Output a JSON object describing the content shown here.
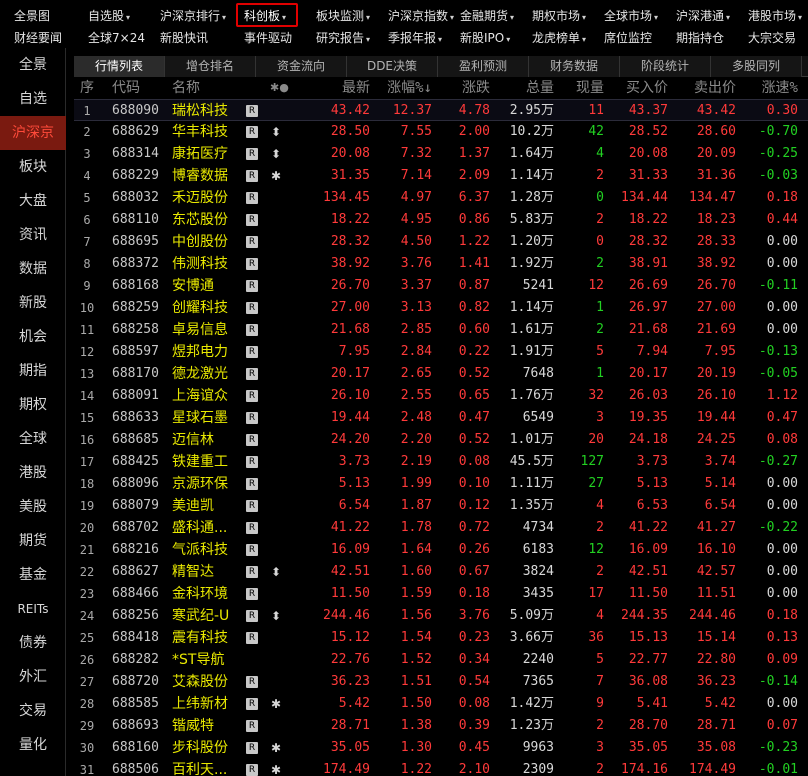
{
  "menu": {
    "row1": [
      {
        "label": "全景图",
        "dropdown": false
      },
      {
        "label": "自选股",
        "dropdown": true
      },
      {
        "label": "沪深京排行",
        "dropdown": true
      },
      {
        "label": "科创板",
        "dropdown": true,
        "active": true
      },
      {
        "label": "板块监测",
        "dropdown": true
      },
      {
        "label": "沪深京指数",
        "dropdown": true
      },
      {
        "label": "金融期货",
        "dropdown": true
      },
      {
        "label": "期权市场",
        "dropdown": true
      },
      {
        "label": "全球市场",
        "dropdown": true
      },
      {
        "label": "沪深港通",
        "dropdown": true
      },
      {
        "label": "港股市场",
        "dropdown": true
      }
    ],
    "row2": [
      {
        "label": "财经要闻",
        "dropdown": false
      },
      {
        "label": "全球7×24",
        "dropdown": false
      },
      {
        "label": "新股快讯",
        "dropdown": false
      },
      {
        "label": "事件驱动",
        "dropdown": false
      },
      {
        "label": "研究报告",
        "dropdown": true
      },
      {
        "label": "季报年报",
        "dropdown": true
      },
      {
        "label": "新股IPO",
        "dropdown": true
      },
      {
        "label": "龙虎榜单",
        "dropdown": true
      },
      {
        "label": "席位监控",
        "dropdown": false
      },
      {
        "label": "期指持仓",
        "dropdown": false
      },
      {
        "label": "大宗交易",
        "dropdown": false
      }
    ]
  },
  "sidebar": {
    "items": [
      "全景",
      "自选",
      "沪深京",
      "板块",
      "大盘",
      "资讯",
      "数据",
      "新股",
      "机会",
      "期指",
      "期权",
      "全球",
      "港股",
      "美股",
      "期货",
      "基金",
      "REITs",
      "债券",
      "外汇",
      "交易",
      "量化"
    ],
    "active_index": 2
  },
  "tabs": {
    "items": [
      "行情列表",
      "增仓排名",
      "资金流向",
      "DDE决策",
      "盈利预测",
      "财务数据",
      "阶段统计",
      "多股同列"
    ],
    "active_index": 0
  },
  "table": {
    "headers": {
      "seq": "序",
      "code": "代码",
      "name": "名称",
      "flags": "✱●",
      "latest": "最新",
      "pct": "涨幅%↓",
      "chg": "涨跌",
      "vol": "总量",
      "cur": "现量",
      "buy": "买入价",
      "sell": "卖出价",
      "spd": "涨速%"
    },
    "rows": [
      {
        "seq": "1",
        "code": "688090",
        "name": "瑞松科技",
        "r": true,
        "flag": "",
        "latest": "43.42",
        "pct": "12.37",
        "chg": "4.78",
        "vol": "2.95万",
        "cur": "11",
        "cur_color": "red",
        "buy": "43.37",
        "sell": "43.42",
        "spd": "0.30",
        "spd_color": "red"
      },
      {
        "seq": "2",
        "code": "688629",
        "name": "华丰科技",
        "r": true,
        "flag": "⬍",
        "latest": "28.50",
        "pct": "7.55",
        "chg": "2.00",
        "vol": "10.2万",
        "cur": "42",
        "cur_color": "green",
        "buy": "28.52",
        "sell": "28.60",
        "spd": "-0.70",
        "spd_color": "green"
      },
      {
        "seq": "3",
        "code": "688314",
        "name": "康拓医疗",
        "r": true,
        "flag": "⬍",
        "latest": "20.08",
        "pct": "7.32",
        "chg": "1.37",
        "vol": "1.64万",
        "cur": "4",
        "cur_color": "green",
        "buy": "20.08",
        "sell": "20.09",
        "spd": "-0.25",
        "spd_color": "green"
      },
      {
        "seq": "4",
        "code": "688229",
        "name": "博睿数据",
        "r": true,
        "flag": "✱",
        "latest": "31.35",
        "pct": "7.14",
        "chg": "2.09",
        "vol": "1.14万",
        "cur": "2",
        "cur_color": "red",
        "buy": "31.33",
        "sell": "31.36",
        "spd": "-0.03",
        "spd_color": "green"
      },
      {
        "seq": "5",
        "code": "688032",
        "name": "禾迈股份",
        "r": true,
        "flag": "",
        "latest": "134.45",
        "pct": "4.97",
        "chg": "6.37",
        "vol": "1.28万",
        "cur": "0",
        "cur_color": "green",
        "buy": "134.44",
        "sell": "134.47",
        "spd": "0.18",
        "spd_color": "red"
      },
      {
        "seq": "6",
        "code": "688110",
        "name": "东芯股份",
        "r": true,
        "flag": "",
        "latest": "18.22",
        "pct": "4.95",
        "chg": "0.86",
        "vol": "5.83万",
        "cur": "2",
        "cur_color": "red",
        "buy": "18.22",
        "sell": "18.23",
        "spd": "0.44",
        "spd_color": "red"
      },
      {
        "seq": "7",
        "code": "688695",
        "name": "中创股份",
        "r": true,
        "flag": "",
        "latest": "28.32",
        "pct": "4.50",
        "chg": "1.22",
        "vol": "1.20万",
        "cur": "0",
        "cur_color": "red",
        "buy": "28.32",
        "sell": "28.33",
        "spd": "0.00",
        "spd_color": "white"
      },
      {
        "seq": "8",
        "code": "688372",
        "name": "伟测科技",
        "r": true,
        "flag": "",
        "latest": "38.92",
        "pct": "3.76",
        "chg": "1.41",
        "vol": "1.92万",
        "cur": "2",
        "cur_color": "green",
        "buy": "38.91",
        "sell": "38.92",
        "spd": "0.00",
        "spd_color": "white"
      },
      {
        "seq": "9",
        "code": "688168",
        "name": "安博通",
        "r": true,
        "flag": "",
        "latest": "26.70",
        "pct": "3.37",
        "chg": "0.87",
        "vol": "5241",
        "cur": "12",
        "cur_color": "red",
        "buy": "26.69",
        "sell": "26.70",
        "spd": "-0.11",
        "spd_color": "green"
      },
      {
        "seq": "10",
        "code": "688259",
        "name": "创耀科技",
        "r": true,
        "flag": "",
        "latest": "27.00",
        "pct": "3.13",
        "chg": "0.82",
        "vol": "1.14万",
        "cur": "1",
        "cur_color": "green",
        "buy": "26.97",
        "sell": "27.00",
        "spd": "0.00",
        "spd_color": "white"
      },
      {
        "seq": "11",
        "code": "688258",
        "name": "卓易信息",
        "r": true,
        "flag": "",
        "latest": "21.68",
        "pct": "2.85",
        "chg": "0.60",
        "vol": "1.61万",
        "cur": "2",
        "cur_color": "green",
        "buy": "21.68",
        "sell": "21.69",
        "spd": "0.00",
        "spd_color": "white"
      },
      {
        "seq": "12",
        "code": "688597",
        "name": "煜邦电力",
        "r": true,
        "flag": "",
        "latest": "7.95",
        "pct": "2.84",
        "chg": "0.22",
        "vol": "1.91万",
        "cur": "5",
        "cur_color": "red",
        "buy": "7.94",
        "sell": "7.95",
        "spd": "-0.13",
        "spd_color": "green"
      },
      {
        "seq": "13",
        "code": "688170",
        "name": "德龙激光",
        "r": true,
        "flag": "",
        "latest": "20.17",
        "pct": "2.65",
        "chg": "0.52",
        "vol": "7648",
        "cur": "1",
        "cur_color": "green",
        "buy": "20.17",
        "sell": "20.19",
        "spd": "-0.05",
        "spd_color": "green"
      },
      {
        "seq": "14",
        "code": "688091",
        "name": "上海谊众",
        "r": true,
        "flag": "",
        "latest": "26.10",
        "pct": "2.55",
        "chg": "0.65",
        "vol": "1.76万",
        "cur": "32",
        "cur_color": "red",
        "buy": "26.03",
        "sell": "26.10",
        "spd": "1.12",
        "spd_color": "red"
      },
      {
        "seq": "15",
        "code": "688633",
        "name": "星球石墨",
        "r": true,
        "flag": "",
        "latest": "19.44",
        "pct": "2.48",
        "chg": "0.47",
        "vol": "6549",
        "cur": "3",
        "cur_color": "red",
        "buy": "19.35",
        "sell": "19.44",
        "spd": "0.47",
        "spd_color": "red"
      },
      {
        "seq": "16",
        "code": "688685",
        "name": "迈信林",
        "r": true,
        "flag": "",
        "latest": "24.20",
        "pct": "2.20",
        "chg": "0.52",
        "vol": "1.01万",
        "cur": "20",
        "cur_color": "red",
        "buy": "24.18",
        "sell": "24.25",
        "spd": "0.08",
        "spd_color": "red"
      },
      {
        "seq": "17",
        "code": "688425",
        "name": "铁建重工",
        "r": true,
        "flag": "",
        "latest": "3.73",
        "pct": "2.19",
        "chg": "0.08",
        "vol": "45.5万",
        "cur": "127",
        "cur_color": "green",
        "buy": "3.73",
        "sell": "3.74",
        "spd": "-0.27",
        "spd_color": "green"
      },
      {
        "seq": "18",
        "code": "688096",
        "name": "京源环保",
        "r": true,
        "flag": "",
        "latest": "5.13",
        "pct": "1.99",
        "chg": "0.10",
        "vol": "1.11万",
        "cur": "27",
        "cur_color": "green",
        "buy": "5.13",
        "sell": "5.14",
        "spd": "0.00",
        "spd_color": "white"
      },
      {
        "seq": "19",
        "code": "688079",
        "name": "美迪凯",
        "r": true,
        "flag": "",
        "latest": "6.54",
        "pct": "1.87",
        "chg": "0.12",
        "vol": "1.35万",
        "cur": "4",
        "cur_color": "red",
        "buy": "6.53",
        "sell": "6.54",
        "spd": "0.00",
        "spd_color": "white"
      },
      {
        "seq": "20",
        "code": "688702",
        "name": "盛科通...",
        "r": true,
        "flag": "",
        "latest": "41.22",
        "pct": "1.78",
        "chg": "0.72",
        "vol": "4734",
        "cur": "2",
        "cur_color": "red",
        "buy": "41.22",
        "sell": "41.27",
        "spd": "-0.22",
        "spd_color": "green"
      },
      {
        "seq": "21",
        "code": "688216",
        "name": "气派科技",
        "r": true,
        "flag": "",
        "latest": "16.09",
        "pct": "1.64",
        "chg": "0.26",
        "vol": "6183",
        "cur": "12",
        "cur_color": "green",
        "buy": "16.09",
        "sell": "16.10",
        "spd": "0.00",
        "spd_color": "white"
      },
      {
        "seq": "22",
        "code": "688627",
        "name": "精智达",
        "r": true,
        "flag": "⬍",
        "latest": "42.51",
        "pct": "1.60",
        "chg": "0.67",
        "vol": "3824",
        "cur": "2",
        "cur_color": "red",
        "buy": "42.51",
        "sell": "42.57",
        "spd": "0.00",
        "spd_color": "white"
      },
      {
        "seq": "23",
        "code": "688466",
        "name": "金科环境",
        "r": true,
        "flag": "",
        "latest": "11.50",
        "pct": "1.59",
        "chg": "0.18",
        "vol": "3435",
        "cur": "17",
        "cur_color": "red",
        "buy": "11.50",
        "sell": "11.51",
        "spd": "0.00",
        "spd_color": "white"
      },
      {
        "seq": "24",
        "code": "688256",
        "name": "寒武纪-U",
        "r": true,
        "flag": "⬍",
        "latest": "244.46",
        "pct": "1.56",
        "chg": "3.76",
        "vol": "5.09万",
        "cur": "4",
        "cur_color": "red",
        "buy": "244.35",
        "sell": "244.46",
        "spd": "0.18",
        "spd_color": "red"
      },
      {
        "seq": "25",
        "code": "688418",
        "name": "震有科技",
        "r": true,
        "flag": "",
        "latest": "15.12",
        "pct": "1.54",
        "chg": "0.23",
        "vol": "3.66万",
        "cur": "36",
        "cur_color": "red",
        "buy": "15.13",
        "sell": "15.14",
        "spd": "0.13",
        "spd_color": "red"
      },
      {
        "seq": "26",
        "code": "688282",
        "name": "*ST导航",
        "r": false,
        "flag": "",
        "latest": "22.76",
        "pct": "1.52",
        "chg": "0.34",
        "vol": "2240",
        "cur": "5",
        "cur_color": "red",
        "buy": "22.77",
        "sell": "22.80",
        "spd": "0.09",
        "spd_color": "red"
      },
      {
        "seq": "27",
        "code": "688720",
        "name": "艾森股份",
        "r": true,
        "flag": "",
        "latest": "36.23",
        "pct": "1.51",
        "chg": "0.54",
        "vol": "7365",
        "cur": "7",
        "cur_color": "red",
        "buy": "36.08",
        "sell": "36.23",
        "spd": "-0.14",
        "spd_color": "green"
      },
      {
        "seq": "28",
        "code": "688585",
        "name": "上纬新材",
        "r": true,
        "flag": "✱",
        "latest": "5.42",
        "pct": "1.50",
        "chg": "0.08",
        "vol": "1.42万",
        "cur": "9",
        "cur_color": "red",
        "buy": "5.41",
        "sell": "5.42",
        "spd": "0.00",
        "spd_color": "white"
      },
      {
        "seq": "29",
        "code": "688693",
        "name": "锴威特",
        "r": true,
        "flag": "",
        "latest": "28.71",
        "pct": "1.38",
        "chg": "0.39",
        "vol": "1.23万",
        "cur": "2",
        "cur_color": "red",
        "buy": "28.70",
        "sell": "28.71",
        "spd": "0.07",
        "spd_color": "red"
      },
      {
        "seq": "30",
        "code": "688160",
        "name": "步科股份",
        "r": true,
        "flag": "✱",
        "latest": "35.05",
        "pct": "1.30",
        "chg": "0.45",
        "vol": "9963",
        "cur": "3",
        "cur_color": "red",
        "buy": "35.05",
        "sell": "35.08",
        "spd": "-0.23",
        "spd_color": "green"
      },
      {
        "seq": "31",
        "code": "688506",
        "name": "百利天...",
        "r": true,
        "flag": "✱",
        "latest": "174.49",
        "pct": "1.22",
        "chg": "2.10",
        "vol": "2309",
        "cur": "2",
        "cur_color": "red",
        "buy": "174.16",
        "sell": "174.49",
        "spd": "-0.01",
        "spd_color": "green"
      }
    ]
  }
}
